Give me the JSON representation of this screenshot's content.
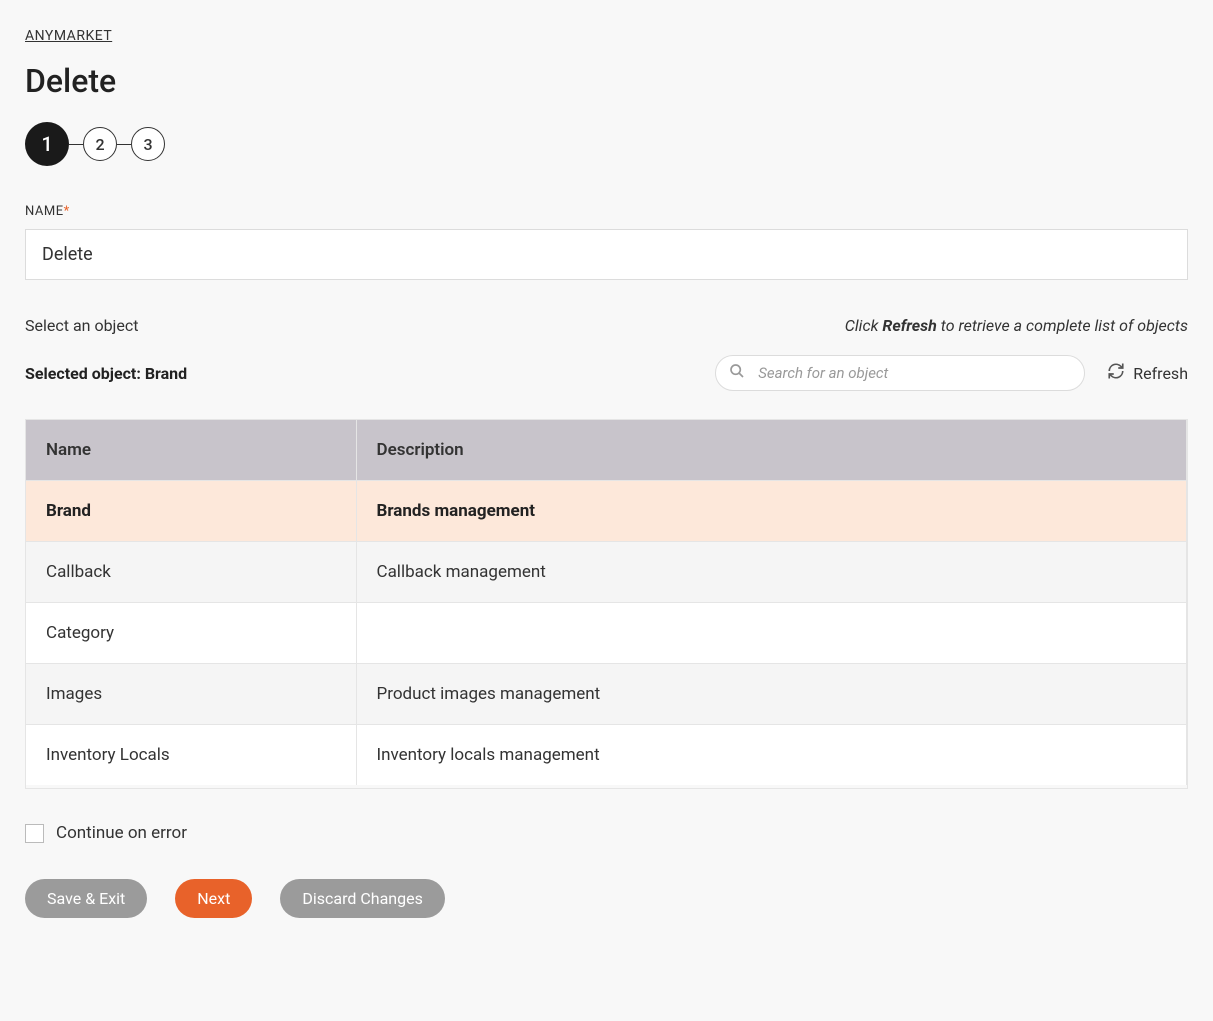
{
  "breadcrumb": "ANYMARKET",
  "page_title": "Delete",
  "stepper": {
    "steps": [
      "1",
      "2",
      "3"
    ],
    "active_index": 0
  },
  "name_field": {
    "label": "NAME",
    "required_mark": "*",
    "value": "Delete"
  },
  "select_section": {
    "label": "Select an object",
    "hint_prefix": "Click ",
    "hint_strong": "Refresh",
    "hint_suffix": " to retrieve a complete list of objects",
    "selected_prefix": "Selected object: ",
    "selected_value": "Brand",
    "search_placeholder": "Search for an object",
    "refresh_label": "Refresh"
  },
  "table": {
    "columns": [
      "Name",
      "Description"
    ],
    "rows": [
      {
        "name": "Brand",
        "description": "Brands management",
        "selected": true
      },
      {
        "name": "Callback",
        "description": "Callback management",
        "selected": false
      },
      {
        "name": "Category",
        "description": "",
        "selected": false
      },
      {
        "name": "Images",
        "description": "Product images management",
        "selected": false
      },
      {
        "name": "Inventory Locals",
        "description": "Inventory locals management",
        "selected": false
      }
    ]
  },
  "continue_error": {
    "label": "Continue on error",
    "checked": false
  },
  "buttons": {
    "save_exit": "Save & Exit",
    "next": "Next",
    "discard": "Discard Changes"
  }
}
